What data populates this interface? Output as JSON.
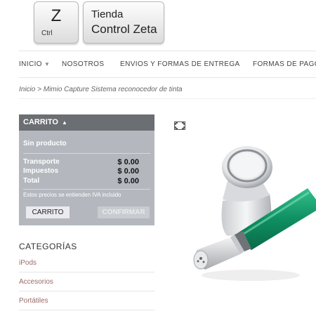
{
  "logo": {
    "key_letter": "Z",
    "key_sub": "Ctrl",
    "name_line1": "Tienda",
    "name_line2": "Control Zeta"
  },
  "nav": {
    "items": [
      "INICIO",
      "NOSOTROS",
      "ENVIOS Y FORMAS DE ENTREGA",
      "FORMAS DE PAGO"
    ]
  },
  "breadcrumb": "Inicio > Mimio Capture Sistema reconocedor de tinta",
  "cart": {
    "title": "CARRITO",
    "empty": "Sin producto",
    "rows": [
      {
        "label": "Transporte",
        "value": "$ 0.00"
      },
      {
        "label": "Impuestos",
        "value": "$ 0.00"
      },
      {
        "label": "Total",
        "value": "$ 0.00"
      }
    ],
    "note": "Estos precios se entienden IVA incluido",
    "cart_button": "CARRITO",
    "confirm_button": "CONFIRMAR"
  },
  "categories": {
    "title": "CATEGORÍAS",
    "items": [
      "iPods",
      "Accesorios",
      "Portátiles"
    ]
  },
  "colors": {
    "cart_header": "#6b6e72",
    "cart_body": "#b4b8be",
    "category_link": "#9a6a6a",
    "pen_green": "#1a9a6c"
  },
  "icons": {
    "expand": "expand-icon",
    "dropdown": "caret-down-icon",
    "cart_toggle": "triangle-up-icon"
  }
}
